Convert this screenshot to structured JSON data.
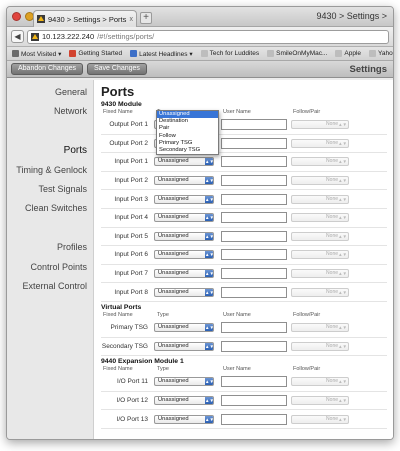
{
  "browser": {
    "tab_title": "9430 > Settings > Ports",
    "tab_close": "x",
    "new_tab": "+",
    "window_title": "9430 > Settings >",
    "url_host": "10.123.222.240",
    "url_path": "/#!/settings/ports/",
    "bookmarks": [
      {
        "label": "Most Visited ▾",
        "color": "#6b6b6b"
      },
      {
        "label": "Getting Started",
        "color": "#d2432f"
      },
      {
        "label": "Latest Headlines ▾",
        "color": "#3d6fc7"
      },
      {
        "label": "Tech for Luddites",
        "color": "#bdbdbd"
      },
      {
        "label": "SmileOnMyMac...",
        "color": "#bdbdbd"
      },
      {
        "label": "Apple",
        "color": "#bdbdbd"
      },
      {
        "label": "Yahoo!",
        "color": "#bdbdbd"
      }
    ]
  },
  "app": {
    "abandon_label": "Abandon Changes",
    "save_label": "Save Changes",
    "title": "Settings"
  },
  "sidebar": {
    "items": [
      {
        "label": "General",
        "name": "general"
      },
      {
        "label": "Network",
        "name": "network"
      },
      {
        "label": "",
        "name": "spacer"
      },
      {
        "label": "Ports",
        "name": "ports",
        "active": true
      },
      {
        "label": "Timing & Genlock",
        "name": "timing-genlock"
      },
      {
        "label": "Test Signals",
        "name": "test-signals"
      },
      {
        "label": "Clean Switches",
        "name": "clean-switches"
      },
      {
        "label": "",
        "name": "spacer2"
      },
      {
        "label": "Profiles",
        "name": "profiles"
      },
      {
        "label": "Control Points",
        "name": "control-points"
      },
      {
        "label": "External Control",
        "name": "external-control"
      }
    ]
  },
  "main": {
    "title": "Ports",
    "columns": {
      "name": "Fixed Name",
      "type": "Type",
      "user": "User Name",
      "follow": "Follow/Pair"
    },
    "sections": [
      {
        "title": "9430 Module",
        "rows": [
          {
            "name": "Output Port 1",
            "type": "Unassigned",
            "follow": "None"
          },
          {
            "name": "Output Port 2",
            "type": "Unassigned",
            "follow": "None"
          },
          {
            "name": "Input Port 1",
            "type": "Unassigned",
            "follow": "None"
          },
          {
            "name": "Input Port 2",
            "type": "Unassigned",
            "follow": "None"
          },
          {
            "name": "Input Port 3",
            "type": "Unassigned",
            "follow": "None"
          },
          {
            "name": "Input Port 4",
            "type": "Unassigned",
            "follow": "None"
          },
          {
            "name": "Input Port 5",
            "type": "Unassigned",
            "follow": "None"
          },
          {
            "name": "Input Port 6",
            "type": "Unassigned",
            "follow": "None"
          },
          {
            "name": "Input Port 7",
            "type": "Unassigned",
            "follow": "None"
          },
          {
            "name": "Input Port 8",
            "type": "Unassigned",
            "follow": "None"
          }
        ]
      },
      {
        "title": "Virtual Ports",
        "rows": [
          {
            "name": "Primary TSG",
            "type": "Unassigned",
            "follow": "None"
          },
          {
            "name": "Secondary TSG",
            "type": "Unassigned",
            "follow": "None"
          }
        ]
      },
      {
        "title": "9440 Expansion Module 1",
        "rows": [
          {
            "name": "I/O Port 11",
            "type": "Unassigned",
            "follow": "None"
          },
          {
            "name": "I/O Port 12",
            "type": "Unassigned",
            "follow": "None"
          },
          {
            "name": "I/O Port 13",
            "type": "Unassigned",
            "follow": "None"
          }
        ]
      }
    ],
    "dropdown_options": [
      "Unassigned",
      "Destination",
      "Pair",
      "Follow",
      "Primary TSG",
      "Secondary TSG"
    ],
    "dropdown_selected": "Unassigned"
  },
  "colors": {
    "accent": "#3875d7",
    "close": "#e0443e",
    "minimize": "#dea123",
    "zoom": "#5fbc3a"
  }
}
